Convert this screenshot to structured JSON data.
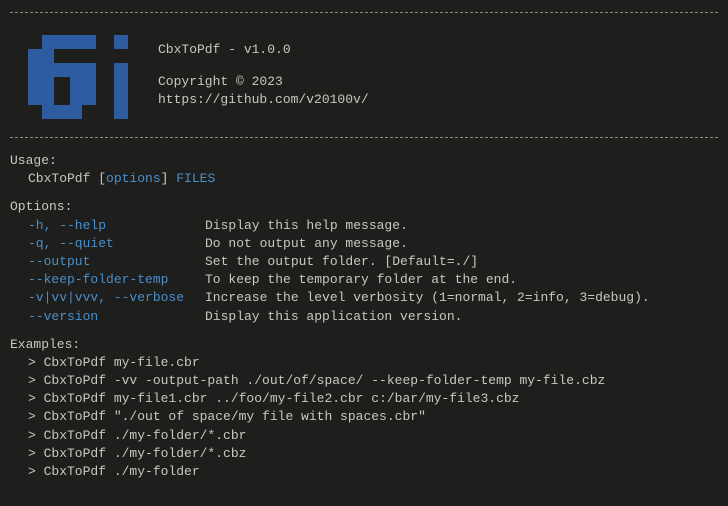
{
  "header": {
    "title": "CbxToPdf - v1.0.0",
    "copyright": "Copyright © 2023",
    "url": "https://github.com/v20100v/"
  },
  "usage": {
    "label": "Usage:",
    "prefix": "CbxToPdf [",
    "options_word": "options",
    "mid": "] ",
    "files_word": "FILES"
  },
  "options": {
    "label": "Options:",
    "rows": [
      {
        "flag": "-h, --help",
        "desc": "Display this help message."
      },
      {
        "flag": "-q, --quiet",
        "desc": "Do not output any message."
      },
      {
        "flag": "--output",
        "desc": "Set the output folder. [Default=./]"
      },
      {
        "flag": "--keep-folder-temp",
        "desc": "To keep the temporary folder at the end."
      },
      {
        "flag": "-v|vv|vvv, --verbose",
        "desc": "Increase the level verbosity (1=normal, 2=info, 3=debug)."
      },
      {
        "flag": "--version",
        "desc": "Display this application version."
      }
    ]
  },
  "examples": {
    "label": "Examples:",
    "lines": [
      "> CbxToPdf my-file.cbr",
      "> CbxToPdf -vv -output-path ./out/of/space/ --keep-folder-temp my-file.cbz",
      "> CbxToPdf my-file1.cbr ../foo/my-file2.cbr c:/bar/my-file3.cbz",
      "> CbxToPdf \"./out of space/my file with spaces.cbr\"",
      "> CbxToPdf ./my-folder/*.cbr",
      "> CbxToPdf ./my-folder/*.cbz",
      "> CbxToPdf ./my-folder"
    ]
  }
}
